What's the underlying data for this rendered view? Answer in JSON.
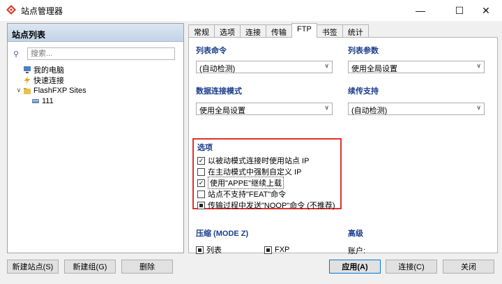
{
  "window": {
    "title": "站点管理器",
    "min": "—",
    "max": "☐",
    "close": "✕",
    "accent": "#0078d7"
  },
  "sidebar": {
    "header": "站点列表",
    "search_placeholder": "搜索...",
    "tree": [
      {
        "label": "我的电脑",
        "icon": "computer-icon",
        "level": 1
      },
      {
        "label": "快速连接",
        "icon": "lightning-icon",
        "level": 1
      },
      {
        "label": "FlashFXP Sites",
        "icon": "folder-icon",
        "level": 1,
        "expanded": true
      },
      {
        "label": "111",
        "icon": "server-icon",
        "level": 2
      }
    ]
  },
  "tabs": [
    {
      "label": "常规"
    },
    {
      "label": "选项"
    },
    {
      "label": "连接"
    },
    {
      "label": "传输"
    },
    {
      "label": "FTP",
      "active": true
    },
    {
      "label": "书签"
    },
    {
      "label": "统计"
    }
  ],
  "ftp": {
    "list_command": {
      "label": "列表命令",
      "value": "(自动检测)"
    },
    "list_params": {
      "label": "列表参数",
      "value": "使用全局设置"
    },
    "data_mode": {
      "label": "数据连接模式",
      "value": "使用全局设置"
    },
    "resume": {
      "label": "续传支持",
      "value": "(自动检测)"
    },
    "options": {
      "label": "选项",
      "items": [
        {
          "label": "以被动模式连接时使用站点 IP",
          "state": "checked"
        },
        {
          "label": "在主动模式中强制自定义 IP",
          "state": "unchecked"
        },
        {
          "label": "使用\"APPE\"继续上载",
          "state": "checked"
        },
        {
          "label": "站点不支持\"FEAT\"命令",
          "state": "unchecked"
        },
        {
          "label": "传输过程中发送\"NOOP\"命令 (不推荐)",
          "state": "indeterminate"
        }
      ]
    },
    "compression": {
      "label": "压缩 (MODE Z)",
      "items": [
        {
          "label": "列表"
        },
        {
          "label": "FXP"
        }
      ]
    },
    "advanced": {
      "label": "高级",
      "account_label": "账户:"
    }
  },
  "buttons": {
    "new_site": "新建站点(S)",
    "new_group": "新建组(G)",
    "delete": "删除",
    "apply": "应用(A)",
    "connect": "连接(C)",
    "close": "关闭"
  }
}
